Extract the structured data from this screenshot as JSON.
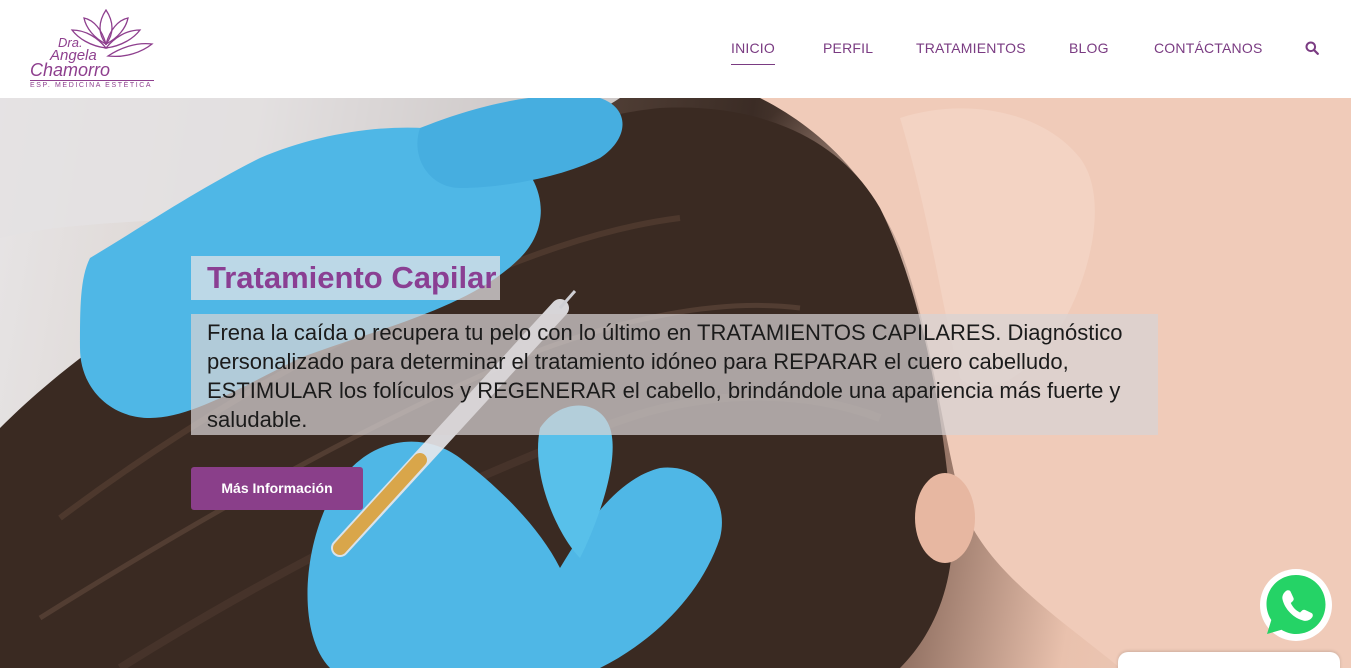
{
  "brand": {
    "line1": "Dra.",
    "line2": "Angela",
    "line3": "Chamorro",
    "subtitle": "ESP. MEDICINA ESTÉTICA",
    "color": "#8e3f8e"
  },
  "nav": {
    "items": [
      {
        "label": "INICIO",
        "active": true
      },
      {
        "label": "PERFIL",
        "active": false
      },
      {
        "label": "TRATAMIENTOS",
        "active": false
      },
      {
        "label": "BLOG",
        "active": false
      },
      {
        "label": "CONTÁCTANOS",
        "active": false
      }
    ],
    "search_icon": "search-icon",
    "color": "#7a3b82"
  },
  "hero": {
    "title": "Tratamiento Capilar",
    "text": "Frena la caída o recupera tu pelo con lo último en TRATAMIENTOS CAPILARES. Diagnóstico personalizado para determinar el tratamiento idóneo para REPARAR el cuero cabelludo, ESTIMULAR los folículos y REGENERAR el cabello, brindándole una apariencia más fuerte y saludable.",
    "cta_label": "Más Información",
    "accent": "#8a3f8a"
  },
  "widgets": {
    "whatsapp_icon": "whatsapp-icon",
    "whatsapp_color": "#25d366"
  }
}
